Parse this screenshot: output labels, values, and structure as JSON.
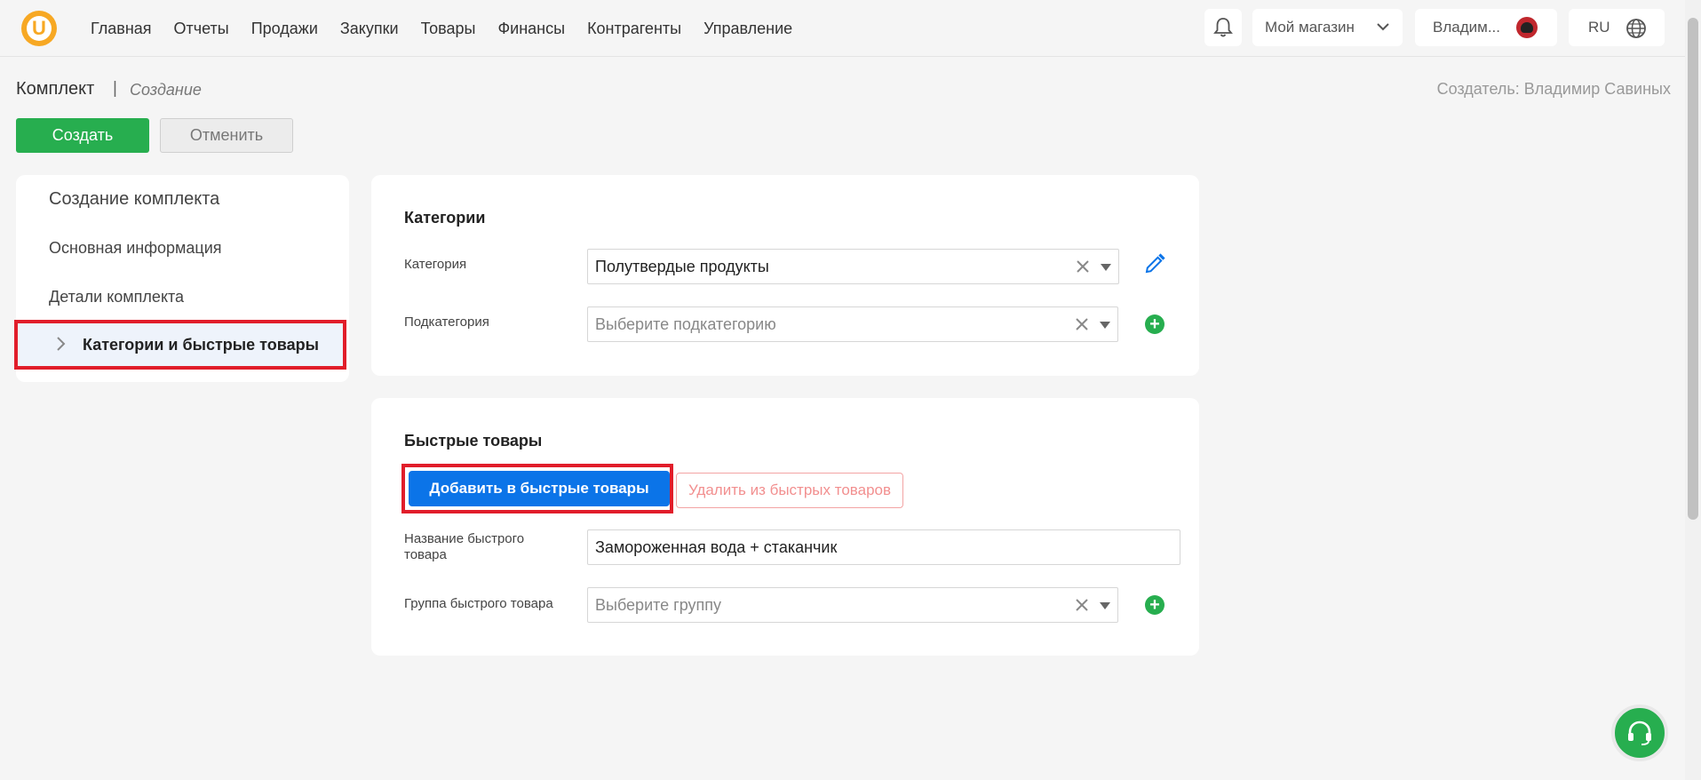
{
  "nav": {
    "items": [
      "Главная",
      "Отчеты",
      "Продажи",
      "Закупки",
      "Товары",
      "Финансы",
      "Контрагенты",
      "Управление"
    ]
  },
  "topbar": {
    "store": "Мой магазин",
    "user": "Владим...",
    "lang": "RU"
  },
  "header": {
    "title": "Комплект",
    "separator": "|",
    "subtitle": "Создание",
    "creator": "Создатель: Владимир Савиных"
  },
  "actions": {
    "create": "Создать",
    "cancel": "Отменить"
  },
  "sidebar": {
    "title": "Создание комплекта",
    "items": [
      "Основная информация",
      "Детали комплекта",
      "Категории и быстрые товары"
    ]
  },
  "categories": {
    "heading": "Категории",
    "category_label": "Категория",
    "category_value": "Полутвердые продукты",
    "subcategory_label": "Подкатегория",
    "subcategory_placeholder": "Выберите подкатегорию"
  },
  "fast": {
    "heading": "Быстрые товары",
    "add_button": "Добавить в быстрые товары",
    "remove_button": "Удалить из быстрых товаров",
    "name_label_1": "Название быстрого",
    "name_label_2": "товара",
    "name_value": "Замороженная вода + стаканчик",
    "group_label": "Группа быстрого товара",
    "group_placeholder": "Выберите группу"
  },
  "colors": {
    "accent_green": "#27ae4f",
    "primary_blue": "#0b74e8",
    "highlight_red": "#e11d2a",
    "logo_orange": "#f7a823"
  }
}
